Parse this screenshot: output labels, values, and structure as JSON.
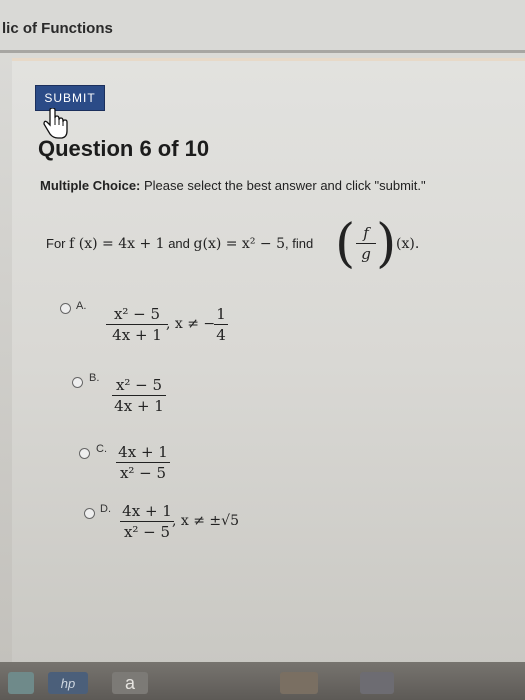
{
  "window": {
    "title": "lic of Functions"
  },
  "toolbar": {
    "submit_label": "SUBMIT"
  },
  "question": {
    "title": "Question 6 of 10",
    "instruction_bold": "Multiple Choice:",
    "instruction_rest": " Please select the best answer and click \"submit.\"",
    "prompt_for": "For",
    "prompt_f": "f (x) = 4x + 1",
    "prompt_and": "and",
    "prompt_g": "g(x) = x² − 5",
    "prompt_find": ", find",
    "find_num": "f",
    "find_den": "g",
    "find_arg": "(x)."
  },
  "options": [
    {
      "letter": "A.",
      "num": "x² − 5",
      "den": "4x + 1",
      "cond": ", x ≠ −",
      "cond_num": "1",
      "cond_den": "4"
    },
    {
      "letter": "B.",
      "num": "x² − 5",
      "den": "4x + 1"
    },
    {
      "letter": "C.",
      "num": "4x + 1",
      "den": "x² − 5"
    },
    {
      "letter": "D.",
      "num": "4x + 1",
      "den": "x² − 5",
      "cond": ", x ≠ ±√5"
    }
  ],
  "taskbar": {
    "hp_label": "hp",
    "a_label": "a"
  },
  "colors": {
    "submit_bg": "#2b4b87",
    "accent_border": "#e7d9c8"
  }
}
